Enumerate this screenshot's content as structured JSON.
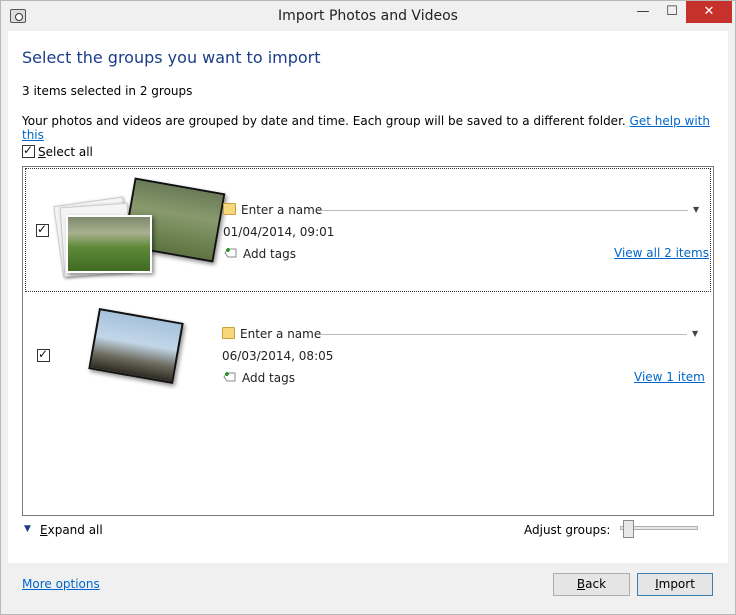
{
  "window": {
    "title": "Import Photos and Videos",
    "minimize_glyph": "—",
    "maximize_glyph": "☐",
    "close_glyph": "✕"
  },
  "dialog": {
    "heading": "Select the groups you want to import",
    "selection_info": "3 items selected in 2 groups",
    "description": "Your photos and videos are grouped by date and time. Each group will be saved to a different folder.",
    "help_link": "Get help with this",
    "select_all": {
      "label": "Select all",
      "checked": true
    }
  },
  "groups": [
    {
      "checked": true,
      "name_placeholder": "Enter a name",
      "date": "01/04/2014, 09:01",
      "tags_label": "Add tags",
      "view_link": "View all 2 items"
    },
    {
      "checked": true,
      "name_placeholder": "Enter a name",
      "date": "06/03/2014, 08:05",
      "tags_label": "Add tags",
      "view_link": "View 1 item"
    }
  ],
  "controls": {
    "expand_all": "Expand all",
    "adjust_groups": "Adjust groups:",
    "adjust_groups_level": 0.05
  },
  "footer": {
    "more_options": "More options",
    "back": "Back",
    "import": "Import"
  },
  "colors": {
    "heading": "#1b3d87",
    "link": "#0066cc",
    "close_button": "#c7312b"
  }
}
